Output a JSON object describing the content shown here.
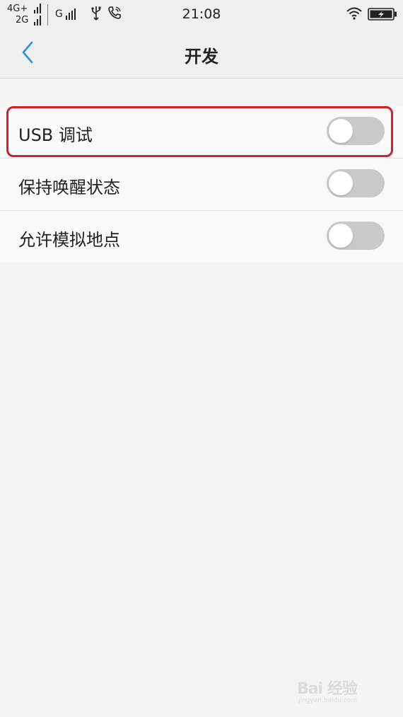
{
  "status_bar": {
    "net1": "4G+",
    "net2": "2G",
    "net3": "G",
    "time": "21:08",
    "icons": [
      "signal-icon",
      "usb-icon",
      "phone-call-icon",
      "wifi-icon",
      "battery-charging-icon"
    ]
  },
  "nav": {
    "title": "开发",
    "back_icon": "chevron-left-icon"
  },
  "settings": [
    {
      "label": "USB 调试",
      "enabled": false,
      "highlighted": true
    },
    {
      "label": "保持唤醒状态",
      "enabled": false,
      "highlighted": false
    },
    {
      "label": "允许模拟地点",
      "enabled": false,
      "highlighted": false
    }
  ],
  "watermark": {
    "text": "Bai 经验",
    "sub": "jingyan.baidu.com"
  },
  "colors": {
    "accent": "#2f8fd6",
    "highlight": "#d21f2a",
    "toggle_off": "#c9c9c9"
  }
}
